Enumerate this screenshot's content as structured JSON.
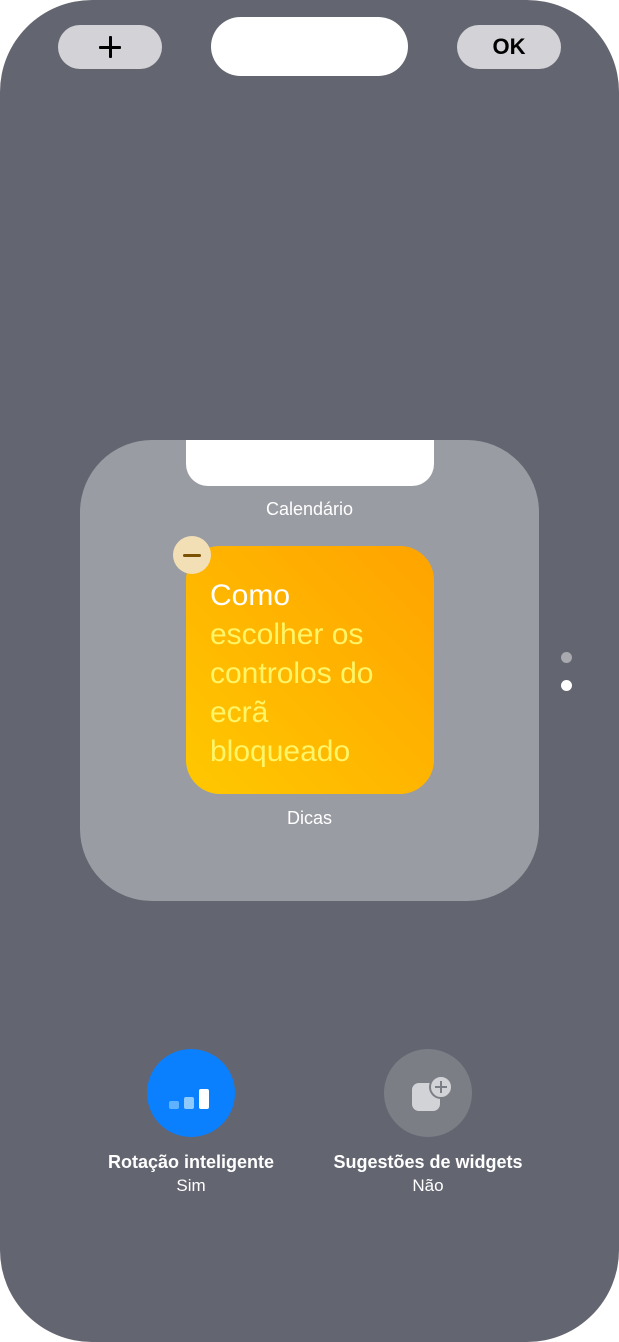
{
  "top_bar": {
    "add_icon": "plus-icon",
    "done_label": "OK"
  },
  "widget_stack": {
    "calendar_label": "Calendário",
    "tips_widget": {
      "text_line_1": "Como",
      "text_lines_highlight": [
        "escolher os",
        "controlos do",
        "ecrã",
        "bloqueado"
      ],
      "colors": {
        "background_start": "#ffc800",
        "background_end": "#ffa300",
        "text_primary": "#ffffff",
        "text_highlight": "#fff566"
      }
    },
    "tips_label": "Dicas",
    "remove_icon": "minus-icon"
  },
  "page_indicator": {
    "pages": 2,
    "current": 2
  },
  "options": {
    "rotation": {
      "title": "Rotação inteligente",
      "value": "Sim",
      "icon": "signal-bars-icon",
      "color": "#0a80ff"
    },
    "suggestions": {
      "title": "Sugestões de widgets",
      "value": "Não",
      "icon": "widget-add-icon",
      "color": "#7c7e86"
    }
  }
}
